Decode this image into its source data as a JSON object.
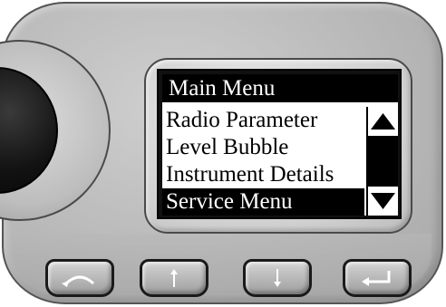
{
  "screen": {
    "title": "Main Menu",
    "menu_items": [
      {
        "label": "Radio Parameter",
        "selected": false
      },
      {
        "label": "Level Bubble",
        "selected": false
      },
      {
        "label": "Instrument Details",
        "selected": false
      },
      {
        "label": "Service Menu",
        "selected": true
      }
    ],
    "scrollbar": {
      "up_icon": "triangle-up-icon",
      "down_icon": "triangle-down-icon"
    }
  },
  "keys": [
    {
      "name": "back-key",
      "icon": "curved-arrow-icon"
    },
    {
      "name": "up-key",
      "icon": "arrow-up-icon"
    },
    {
      "name": "down-key",
      "icon": "arrow-down-icon"
    },
    {
      "name": "enter-key",
      "icon": "enter-return-icon"
    }
  ],
  "colors": {
    "housing": "#b9b9b9",
    "screen_background": "#ffffff",
    "selection": "#000000",
    "title_bar": "#000000"
  }
}
